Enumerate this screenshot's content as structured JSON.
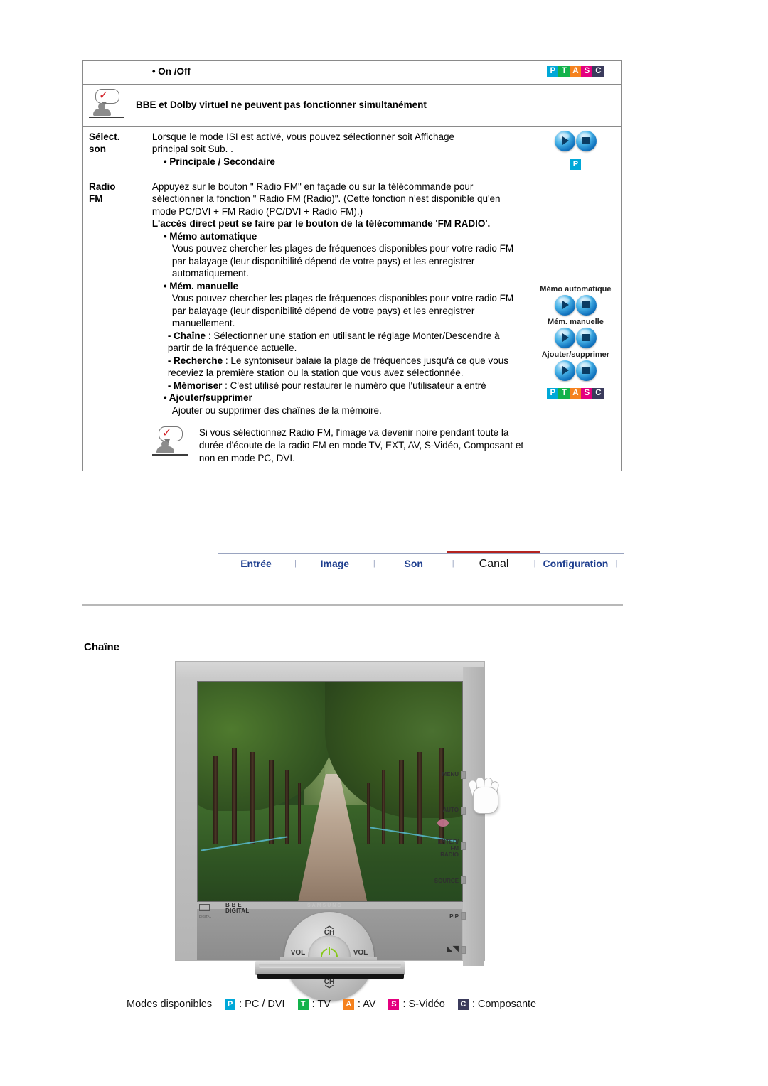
{
  "table": {
    "row_onoff": {
      "label": "",
      "body": "• On /Off",
      "icon_badges": [
        "P",
        "T",
        "A",
        "S",
        "C"
      ]
    },
    "row_note_top": {
      "text": "BBE et Dolby virtuel ne peuvent pas fonctionner simultanément"
    },
    "row_select_son": {
      "label_line1": "Sélect.",
      "label_line2": "son",
      "body_l1": "Lorsque le mode ISI est activé, vous pouvez sélectionner soit Affichage",
      "body_l2": "principal soit Sub. .",
      "bullet": "• Principale / Secondaire",
      "icon_badge": "P"
    },
    "row_radio_fm": {
      "label_line1": "Radio",
      "label_line2": "FM",
      "p1": "Appuyez sur le bouton \" Radio FM\" en façade ou sur la télécommande pour sélectionner la fonction \" Radio FM (Radio)\". (Cette fonction n'est disponible qu'en mode PC/DVI + FM Radio (PC/DVI + Radio FM).)",
      "p2_bold": "L'accès direct peut se faire par le bouton de la télécommande 'FM RADIO'.",
      "b1_title": "• Mémo automatique",
      "b1_text": "Vous pouvez chercher les plages de fréquences disponibles pour votre radio FM par balayage (leur disponibilité dépend de votre pays) et les enregistrer automatiquement.",
      "b2_title": "• Mém. manuelle",
      "b2_text": "Vous pouvez chercher les plages de fréquences disponibles pour votre radio FM par balayage (leur disponibilité dépend de votre pays) et les enregistrer manuellement.",
      "d1_label": "- Chaîne",
      "d1_text": " : Sélectionner une station en utilisant le réglage Monter/Descendre à partir de la fréquence actuelle.",
      "d2_label": "- Recherche",
      "d2_text": " : Le syntoniseur balaie la plage de fréquences jusqu'à ce que vous receviez la première station ou la station que vous avez sélectionnée.",
      "d3_label": "- Mémoriser",
      "d3_text": " : C'est utilisé pour restaurer le numéro que l'utilisateur a entré",
      "b3_title": "• Ajouter/supprimer",
      "b3_text": "Ajouter ou supprimer des chaînes de la mémoire.",
      "note_text": "Si vous sélectionnez Radio FM, l'image va devenir noire pendant toute la durée d'écoute de la radio FM en mode TV, EXT, AV, S-Vidéo, Composant et non en mode PC, DVI.",
      "icon_caption_1": "Mémo automatique",
      "icon_caption_2": "Mém. manuelle",
      "icon_caption_3": "Ajouter/supprimer",
      "icon_badges": [
        "P",
        "T",
        "A",
        "S",
        "C"
      ]
    }
  },
  "nav": {
    "tabs": [
      {
        "label": "Entrée",
        "active": false
      },
      {
        "label": "Image",
        "active": false
      },
      {
        "label": "Son",
        "active": false
      },
      {
        "label": "Canal",
        "active": true
      },
      {
        "label": "Configuration",
        "active": false
      }
    ],
    "separator": "|",
    "active_underline_color": "#b4231f",
    "link_color": "#1f3f8f"
  },
  "section": {
    "title": "Chaîne"
  },
  "monitor": {
    "logo_bbe": "B B E",
    "logo_bbe_sub": "DIGITAL",
    "logo_dolby_text": "DIGITAL",
    "brand": "SAMSUNG",
    "wheel": {
      "ch_up": "CH",
      "ch_down": "CH",
      "vol_down": "VOL",
      "vol_down_sign": "–",
      "vol_up": "VOL",
      "vol_up_sign": "+",
      "power": "power-button"
    },
    "side_buttons": [
      {
        "label": "MENU"
      },
      {
        "label": "AUTO"
      },
      {
        "label": "ENTER/",
        "label2": "FM RADIO"
      },
      {
        "label": "SOURCE"
      },
      {
        "label": "PIP"
      },
      {
        "label": ""
      }
    ]
  },
  "modes": {
    "label": "Modes disponibles",
    "items": [
      {
        "badge": "P",
        "color": "#00a8d8",
        "text": ": PC / DVI"
      },
      {
        "badge": "T",
        "color": "#13b24b",
        "text": ": TV"
      },
      {
        "badge": "A",
        "color": "#f5821f",
        "text": ": AV"
      },
      {
        "badge": "S",
        "color": "#e4007f",
        "text": ": S-Vidéo"
      },
      {
        "badge": "C",
        "color": "#3b3b5c",
        "text": ": Composante"
      }
    ]
  }
}
